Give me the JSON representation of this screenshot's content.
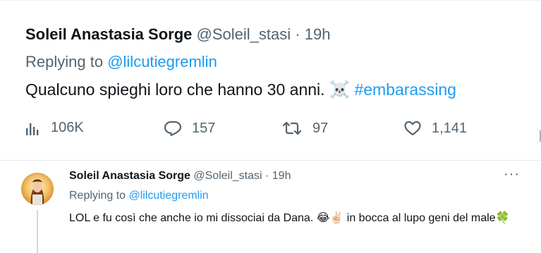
{
  "tweet1": {
    "name": "Soleil Anastasia Sorge",
    "handle": "@Soleil_stasi",
    "separator": "·",
    "time": "19h",
    "replying_prefix": "Replying to",
    "replying_mention": "@lilcutiegremlin",
    "text": "Qualcuno spieghi loro che hanno 30 anni.",
    "emoji": "☠️",
    "hashtag": "#embarassing",
    "stats": {
      "views": "106K",
      "replies": "157",
      "retweets": "97",
      "likes": "1,141"
    }
  },
  "tweet2": {
    "name": "Soleil Anastasia Sorge",
    "handle": "@Soleil_stasi",
    "separator": "·",
    "time": "19h",
    "more": "···",
    "replying_prefix": "Replying to",
    "replying_mention": "@lilcutiegremlin",
    "text": "LOL e fu così che anche io mi dissociai da Dana. 😂✌🏻 in bocca al lupo geni del male🍀"
  },
  "icons": [
    "views-icon",
    "reply-icon",
    "retweet-icon",
    "like-icon",
    "more-icon"
  ],
  "colors": {
    "accent": "#1d9bf0",
    "secondary_text": "#536471",
    "primary_text": "#0f1419"
  }
}
